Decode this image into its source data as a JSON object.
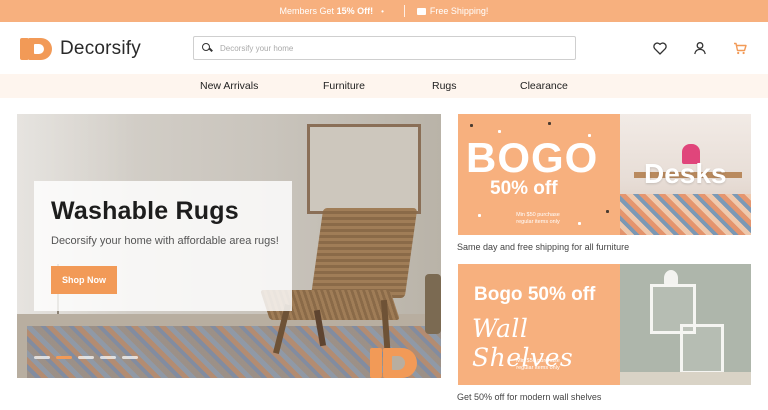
{
  "promo_bar": {
    "members_prefix": "Members Get ",
    "members_highlight": "15% Off!",
    "dot": "•",
    "shipping": "Free Shipping!"
  },
  "header": {
    "brand": "Decorsify",
    "search_placeholder": "Decorsify your home",
    "icons": [
      "heart-icon",
      "user-icon",
      "cart-icon"
    ]
  },
  "nav": {
    "items": [
      "New Arrivals",
      "Furniture",
      "Rugs",
      "Clearance"
    ]
  },
  "hero": {
    "title": "Washable Rugs",
    "subtitle": "Decorsify your home with affordable area rugs!",
    "cta": "Shop Now",
    "slides": 5,
    "active_slide": 2
  },
  "promo_desks": {
    "headline": "BOGO",
    "offer": "50% off",
    "fine_print": "Min $50 purchase regular items only",
    "label": "Desks",
    "caption": "Same day and free shipping for all furniture"
  },
  "promo_shelves": {
    "headline": "Bogo 50% off",
    "label": "Wall Shelves",
    "fine_print": "Min $50 purchase regular items only",
    "caption": "Get 50% off for modern wall shelves"
  },
  "colors": {
    "accent": "#f29a57",
    "promo_bg": "#f7b07e",
    "nav_bg": "#fef5ee"
  }
}
